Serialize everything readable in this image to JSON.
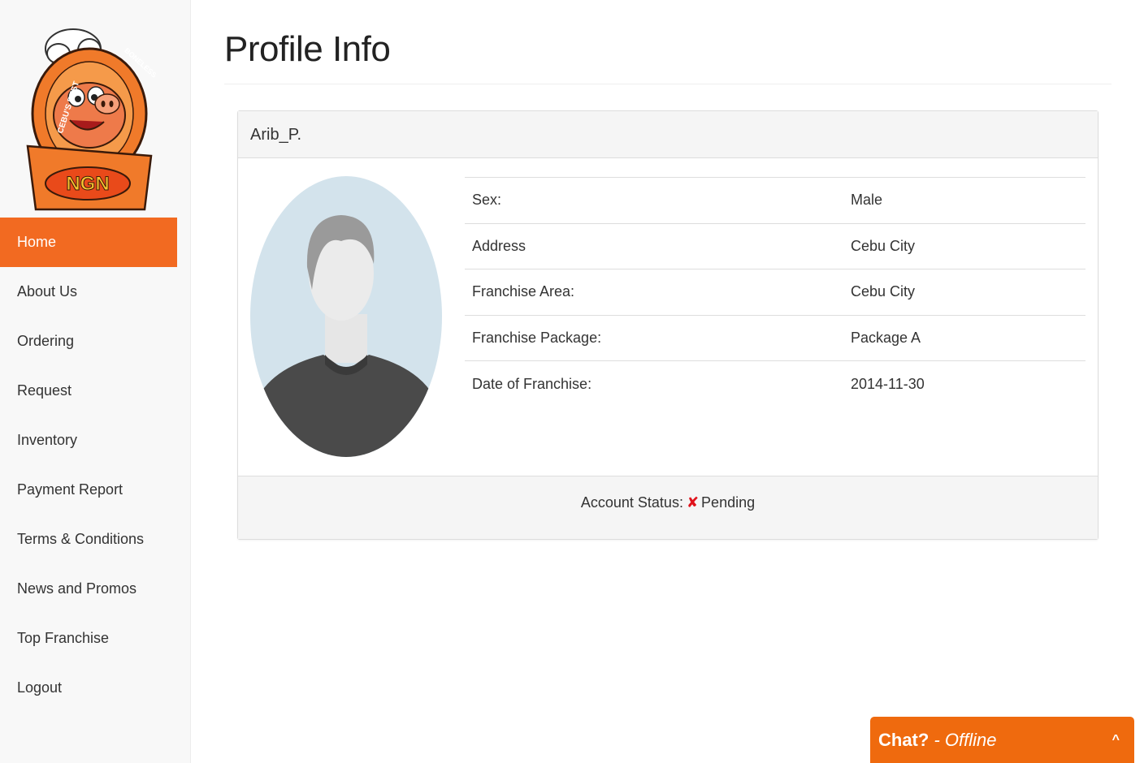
{
  "sidebar": {
    "logo": {
      "arc_text_left": "CEBU'S BEST",
      "arc_text_right": "BONELESS LECHON",
      "badge": "NGN"
    },
    "items": [
      {
        "label": "Home",
        "active": true
      },
      {
        "label": "About Us"
      },
      {
        "label": "Ordering"
      },
      {
        "label": "Request"
      },
      {
        "label": "Inventory"
      },
      {
        "label": "Payment Report"
      },
      {
        "label": "Terms & Conditions"
      },
      {
        "label": "News and Promos"
      },
      {
        "label": "Top Franchise"
      },
      {
        "label": "Logout"
      }
    ]
  },
  "main": {
    "title": "Profile Info",
    "panel": {
      "heading": "Arib_P.",
      "rows": [
        {
          "label": "Sex:",
          "value": "Male"
        },
        {
          "label": "Address",
          "value": "Cebu City"
        },
        {
          "label": "Franchise Area:",
          "value": "Cebu City"
        },
        {
          "label": "Franchise Package:",
          "value": "Package A"
        },
        {
          "label": "Date of Franchise:",
          "value": "2014-11-30"
        }
      ],
      "footer": {
        "status_label": "Account Status:",
        "status_icon": "x-icon",
        "status_value": "Pending"
      }
    }
  },
  "chat": {
    "title": "Chat?",
    "separator": " - ",
    "status": "Offline",
    "caret": "^"
  },
  "colors": {
    "accent": "#f26a21",
    "chat": "#ef6a0e",
    "status_x": "#e0121b",
    "avatar_bg": "#d3e3ec"
  }
}
